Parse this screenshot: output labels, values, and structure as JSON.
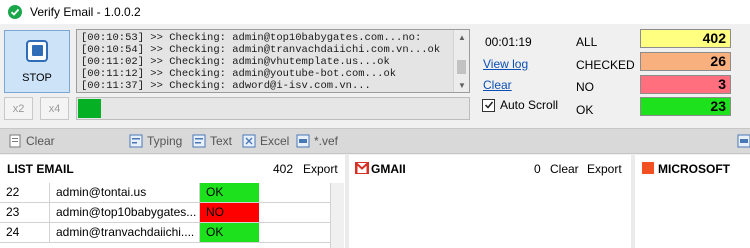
{
  "window": {
    "title": "Verify Email - 1.0.0.2"
  },
  "controls": {
    "stop_label": "STOP",
    "mult2_label": "x2",
    "mult4_label": "x4"
  },
  "log": [
    "[00:10:53]  >> Checking: admin@top10babygates.com...no:",
    "[00:10:54]  >> Checking: admin@tranvachdaiichi.com.vn...ok",
    "[00:11:02]  >> Checking: admin@vhutemplate.us...ok",
    "[00:11:12]  >> Checking: admin@youtube-bot.com...ok",
    "[00:11:37]  >> Checking: adword@i-isv.com.vn..."
  ],
  "progress": {
    "fraction": 0.06
  },
  "timer": "00:01:19",
  "links": {
    "view_log": "View log",
    "clear": "Clear"
  },
  "auto_scroll": {
    "label": "Auto Scroll",
    "checked": true
  },
  "stats": [
    {
      "label": "ALL",
      "value": "402",
      "color": "#ffff80"
    },
    {
      "label": "CHECKED",
      "value": "26",
      "color": "#f8b07f"
    },
    {
      "label": "NO",
      "value": "3",
      "color": "#ff6f7d"
    },
    {
      "label": "OK",
      "value": "23",
      "color": "#1ee11e"
    }
  ],
  "toolbar": {
    "clear": "Clear",
    "typing": "Typing",
    "text": "Text",
    "excel": "Excel",
    "vef": "*.vef"
  },
  "list_email": {
    "title": "LIST EMAIL",
    "count": "402",
    "export": "Export",
    "rows": [
      {
        "no": "22",
        "email": "admin@tontai.us",
        "status": "OK",
        "color": "#1ee11e"
      },
      {
        "no": "23",
        "email": "admin@top10babygates...",
        "status": "NO",
        "color": "#ff0000"
      },
      {
        "no": "24",
        "email": "admin@tranvachdaiichi....",
        "status": "OK",
        "color": "#1ee11e"
      }
    ]
  },
  "gmail": {
    "title": "GMAII",
    "count": "0",
    "clear": "Clear",
    "export": "Export",
    "brand_color": "#d93025"
  },
  "microsoft": {
    "title": "MICROSOFT",
    "brand_color": "#f25022"
  }
}
